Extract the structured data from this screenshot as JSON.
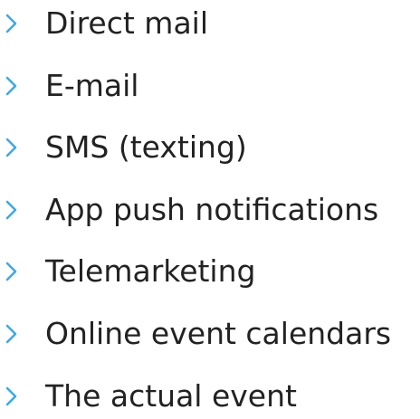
{
  "accent_color": "#3fa9e4",
  "text_color": "#222222",
  "bullet_icon": "chevron-right-icon",
  "items": [
    {
      "label": "Direct mail"
    },
    {
      "label": "E-mail"
    },
    {
      "label": "SMS (texting)"
    },
    {
      "label": "App push notifications"
    },
    {
      "label": "Telemarketing"
    },
    {
      "label": "Online event calendars"
    },
    {
      "label": "The actual event"
    }
  ]
}
